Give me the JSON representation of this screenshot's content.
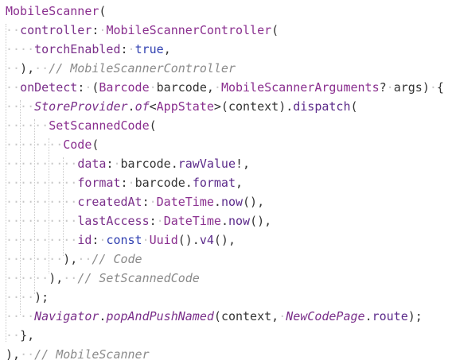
{
  "editor": {
    "language": "dart",
    "lines": [
      "MobileScanner(",
      "  controller: MobileScannerController(",
      "    torchEnabled: true,",
      "  ),  // MobileScannerController",
      "  onDetect: (Barcode barcode, MobileScannerArguments? args) {",
      "    StoreProvider.of<AppState>(context).dispatch(",
      "      SetScannedCode(",
      "        Code(",
      "          data: barcode.rawValue!,",
      "          format: barcode.format,",
      "          createdAt: DateTime.now(),",
      "          lastAccess: DateTime.now(),",
      "          id: const Uuid().v4(),",
      "        ),  // Code",
      "      ),  // SetScannedCode",
      "    );",
      "    Navigator.popAndPushNamed(context, NewCodePage.route);",
      "  },",
      "),  // MobileScanner"
    ],
    "colors": {
      "background": "#ffffff",
      "class_name": "#8a2f8f",
      "keyword": "#2f3fb0",
      "comment": "#8a8a8a",
      "plain": "#333333",
      "indent_guide": "#c9c9c9"
    }
  }
}
